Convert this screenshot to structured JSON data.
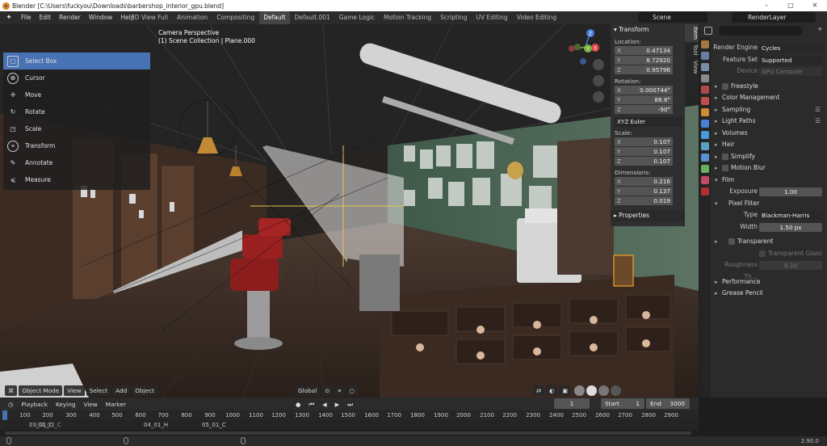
{
  "window": {
    "title": "Blender [C:\\Users\\fuckyou\\Downloads\\barbershop_interior_gpu.blend]",
    "controls": [
      "–",
      "□",
      "✕"
    ]
  },
  "menubar": {
    "items": [
      "File",
      "Edit",
      "Render",
      "Window",
      "Help"
    ],
    "workspaces": [
      "3D View Full",
      "Animation",
      "Compositing",
      "Default",
      "Default.001",
      "Game Logic",
      "Motion Tracking",
      "Scripting",
      "UV Editing",
      "Video Editing"
    ],
    "active_workspace": "Default",
    "scene": "Scene",
    "view_layer": "RenderLayer"
  },
  "toolbar": {
    "tools": [
      {
        "label": "Select Box",
        "icon": "select-box-icon",
        "glyph": "▢",
        "active": true
      },
      {
        "label": "Cursor",
        "icon": "cursor-icon",
        "glyph": "⊕",
        "active": false
      },
      {
        "label": "Move",
        "icon": "move-icon",
        "glyph": "✛",
        "active": false
      },
      {
        "label": "Rotate",
        "icon": "rotate-icon",
        "glyph": "↻",
        "active": false
      },
      {
        "label": "Scale",
        "icon": "scale-icon",
        "glyph": "◳",
        "active": false
      },
      {
        "label": "Transform",
        "icon": "transform-icon",
        "glyph": "⌖",
        "active": false
      },
      {
        "label": "Annotate",
        "icon": "annotate-icon",
        "glyph": "✎",
        "active": false
      },
      {
        "label": "Measure",
        "icon": "measure-icon",
        "glyph": "⩽",
        "active": false
      }
    ]
  },
  "viewport": {
    "camera_label": "Camera Perspective",
    "collection_label": "(1) Scene Collection | Plane.000",
    "gizmo_axes": [
      "X",
      "Y",
      "Z"
    ],
    "header": {
      "mode": "Object Mode",
      "menus": [
        "View",
        "Select",
        "Add",
        "Object"
      ],
      "orientation": "Global"
    }
  },
  "npanel": {
    "section": "Transform",
    "location_label": "Location:",
    "location": [
      {
        "axis": "X",
        "value": "0.47134"
      },
      {
        "axis": "Y",
        "value": "8.72920"
      },
      {
        "axis": "Z",
        "value": "0.95796"
      }
    ],
    "rotation_label": "Rotation:",
    "rotation": [
      {
        "axis": "X",
        "value": "0.000744°"
      },
      {
        "axis": "Y",
        "value": "88.8°"
      },
      {
        "axis": "Z",
        "value": "-90°"
      }
    ],
    "rotation_mode": "XYZ Euler",
    "scale_label": "Scale:",
    "scale": [
      {
        "axis": "X",
        "value": "0.107"
      },
      {
        "axis": "Y",
        "value": "0.107"
      },
      {
        "axis": "Z",
        "value": "0.107"
      }
    ],
    "dimensions_label": "Dimensions:",
    "dimensions": [
      {
        "axis": "X",
        "value": "0.216"
      },
      {
        "axis": "Y",
        "value": "0.137"
      },
      {
        "axis": "Z",
        "value": "0.019"
      }
    ],
    "properties_section": "Properties",
    "tabs": [
      "Item",
      "Tool",
      "View"
    ]
  },
  "properties": {
    "render_engine_label": "Render Engine",
    "render_engine": "Cycles",
    "feature_set_label": "Feature Set",
    "feature_set": "Supported",
    "device_label": "Device",
    "device": "GPU Compute",
    "sections": [
      "Freestyle",
      "Color Management",
      "Sampling",
      "Light Paths",
      "Volumes",
      "Hair",
      "Simplify",
      "Motion Blur",
      "Film"
    ],
    "film": {
      "exposure_label": "Exposure",
      "exposure": "1.00",
      "pixel_filter_label": "Pixel Filter",
      "type_label": "Type",
      "type": "Blackman-Harris",
      "width_label": "Width",
      "width": "1.50 px",
      "transparent_label": "Transparent",
      "transparent_glass_label": "Transparent Glass",
      "roughness_label": "Roughness Th...",
      "roughness": "0.10"
    },
    "bottom_sections": [
      "Performance",
      "Grease Pencil"
    ]
  },
  "timeline": {
    "menus": [
      "Playback",
      "Keying",
      "View",
      "Marker"
    ],
    "current_frame": "1",
    "start_label": "Start",
    "start": "1",
    "end_label": "End",
    "end": "3000",
    "ticks": [
      "1",
      "100",
      "200",
      "300",
      "400",
      "500",
      "600",
      "700",
      "800",
      "900",
      "1000",
      "1100",
      "1200",
      "1300",
      "1400",
      "1500",
      "1600",
      "1700",
      "1800",
      "1900",
      "2000",
      "2100",
      "2200",
      "2300",
      "2400",
      "2500",
      "2600",
      "2700",
      "2800",
      "2900"
    ],
    "markers": [
      "03_01_C",
      "03_03_C",
      "04_01_H",
      "05_01_C"
    ]
  },
  "status": {
    "version": "2.90.0"
  },
  "colors": {
    "accent": "#4772b3",
    "panel": "#2b2b2b",
    "field": "#545454"
  }
}
